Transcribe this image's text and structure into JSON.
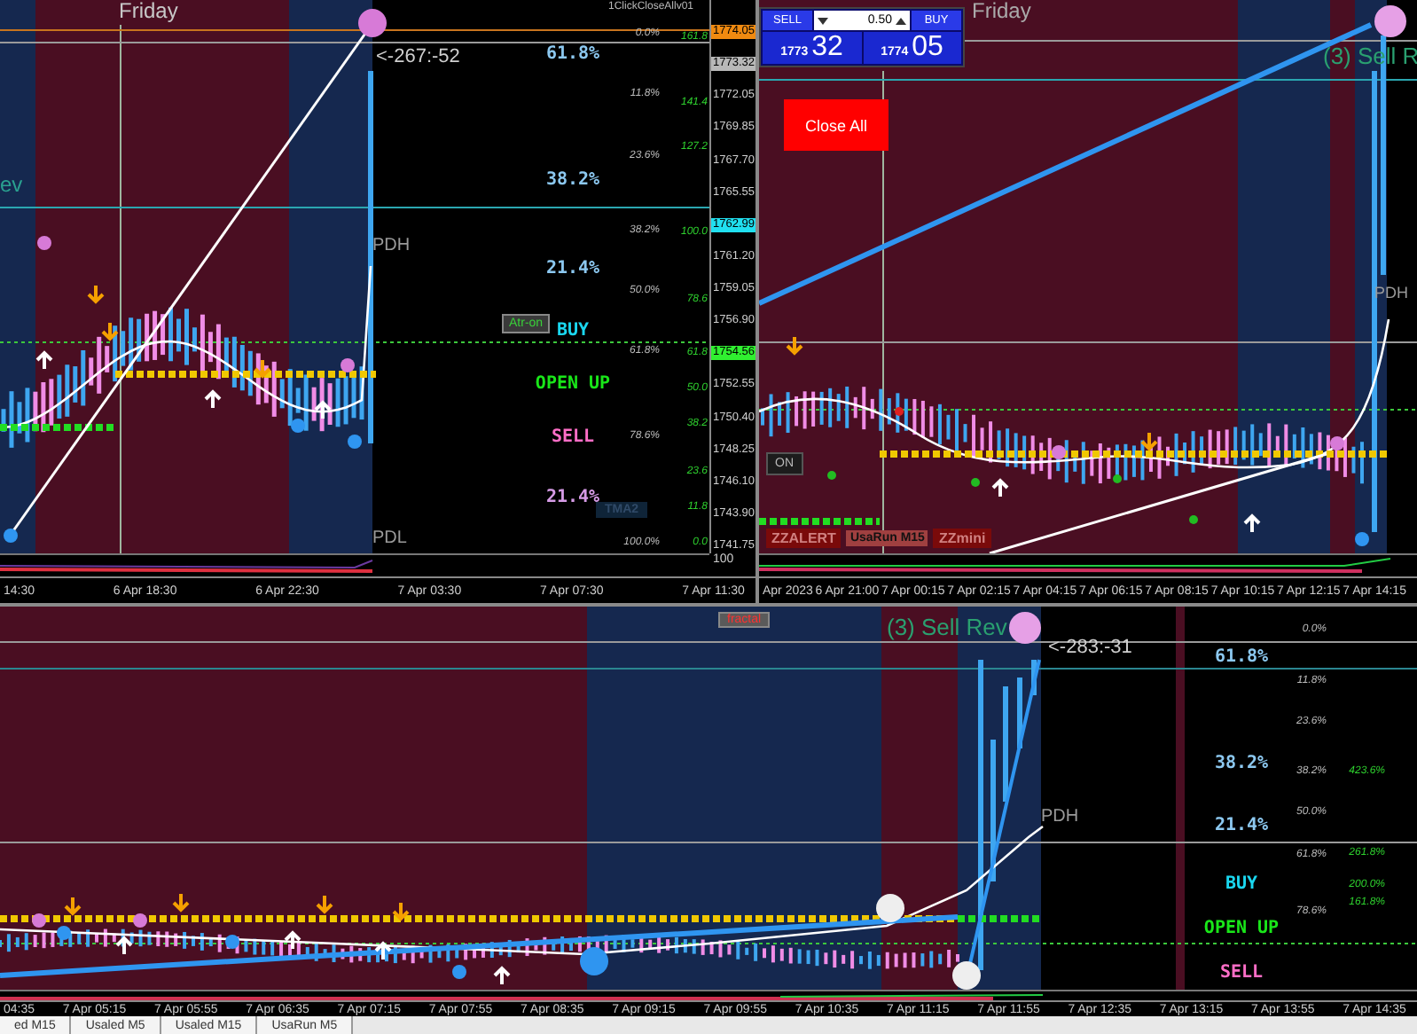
{
  "chart_left": {
    "day_label": "Friday",
    "expert_label": "1ClickCloseAllv01",
    "signal_text": "ev",
    "pivot_labels": [
      "<-267:-52",
      "PDH",
      "PDL"
    ],
    "levels": [
      {
        "text": "61.8%",
        "kind": "level"
      },
      {
        "text": "38.2%",
        "kind": "level"
      },
      {
        "text": "21.4%",
        "kind": "level"
      },
      {
        "text": "BUY",
        "kind": "buy"
      },
      {
        "text": "OPEN UP",
        "kind": "open"
      },
      {
        "text": "SELL",
        "kind": "sell"
      },
      {
        "text": "21.4%",
        "kind": "level_low"
      }
    ],
    "atr_button": "Atr-on",
    "tma_label": "TMA2",
    "retracements": [
      "0.0%",
      "11.8%",
      "23.6%",
      "38.2%",
      "50.0%",
      "61.8%",
      "78.6%",
      "100.0%"
    ],
    "extensions": [
      "161.8",
      "141.4",
      "127.2",
      "100.0",
      "78.6",
      "61.8",
      "50.0",
      "38.2",
      "23.6",
      "11.8",
      "0.0"
    ],
    "price_axis": [
      {
        "text": "1774.05",
        "kind": "ask"
      },
      {
        "text": "1773.32",
        "kind": "bid"
      },
      {
        "text": "1772.05",
        "kind": "plain"
      },
      {
        "text": "1769.85",
        "kind": "plain"
      },
      {
        "text": "1767.70",
        "kind": "plain"
      },
      {
        "text": "1765.55",
        "kind": "plain"
      },
      {
        "text": "1762.99",
        "kind": "line"
      },
      {
        "text": "1761.20",
        "kind": "plain"
      },
      {
        "text": "1759.05",
        "kind": "plain"
      },
      {
        "text": "1756.90",
        "kind": "plain"
      },
      {
        "text": "1754.56",
        "kind": "open"
      },
      {
        "text": "1752.55",
        "kind": "plain"
      },
      {
        "text": "1750.40",
        "kind": "plain"
      },
      {
        "text": "1748.25",
        "kind": "plain"
      },
      {
        "text": "1746.10",
        "kind": "plain"
      },
      {
        "text": "1743.90",
        "kind": "plain"
      },
      {
        "text": "1741.75",
        "kind": "plain"
      }
    ],
    "indicator_scale": "100",
    "time_axis": [
      "14:30",
      "6 Apr 18:30",
      "6 Apr 22:30",
      "7 Apr 03:30",
      "7 Apr 07:30",
      "7 Apr 11:30"
    ]
  },
  "chart_right": {
    "trade_panel": {
      "sell": "SELL",
      "lot": "0.50",
      "buy": "BUY",
      "sell_prefix": "1773",
      "sell_points": "32",
      "buy_prefix": "1774",
      "buy_points": "05"
    },
    "close_all": "Close All",
    "day_label": "Friday",
    "signal_text": "(3) Sell R",
    "pivot_labels": [
      "PDH"
    ],
    "on_button": "ON",
    "zz_buttons": [
      "ZZALERT",
      "ZZmini"
    ],
    "symbol_label": "UsaRun M15",
    "time_axis": [
      "Apr 2023",
      "6 Apr 21:00",
      "7 Apr 00:15",
      "7 Apr 02:15",
      "7 Apr 04:15",
      "7 Apr 06:15",
      "7 Apr 08:15",
      "7 Apr 10:15",
      "7 Apr 12:15",
      "7 Apr 14:15"
    ]
  },
  "chart_bottom": {
    "fractal_button": "fractal",
    "signal_text": "(3) Sell Rev",
    "pivot_labels": [
      "<-283:-31",
      "PDH"
    ],
    "levels": [
      {
        "text": "61.8%",
        "kind": "level"
      },
      {
        "text": "38.2%",
        "kind": "level"
      },
      {
        "text": "21.4%",
        "kind": "level"
      },
      {
        "text": "BUY",
        "kind": "buy"
      },
      {
        "text": "OPEN UP",
        "kind": "open"
      },
      {
        "text": "SELL",
        "kind": "sell"
      }
    ],
    "retracements": [
      "0.0%",
      "11.8%",
      "23.6%",
      "38.2%",
      "50.0%",
      "61.8%",
      "78.6%"
    ],
    "extensions": [
      "423.6%",
      "261.8%",
      "200.0%",
      "161.8%"
    ],
    "time_axis": [
      "04:35",
      "7 Apr 05:15",
      "7 Apr 05:55",
      "7 Apr 06:35",
      "7 Apr 07:15",
      "7 Apr 07:55",
      "7 Apr 08:35",
      "7 Apr 09:15",
      "7 Apr 09:55",
      "7 Apr 10:35",
      "7 Apr 11:15",
      "7 Apr 11:55",
      "7 Apr 12:35",
      "7 Apr 13:15",
      "7 Apr 13:55",
      "7 Apr 14:35"
    ]
  },
  "tabs": [
    "ed M15",
    "Usaled M5",
    "Usaled M15",
    "UsaRun M5"
  ]
}
